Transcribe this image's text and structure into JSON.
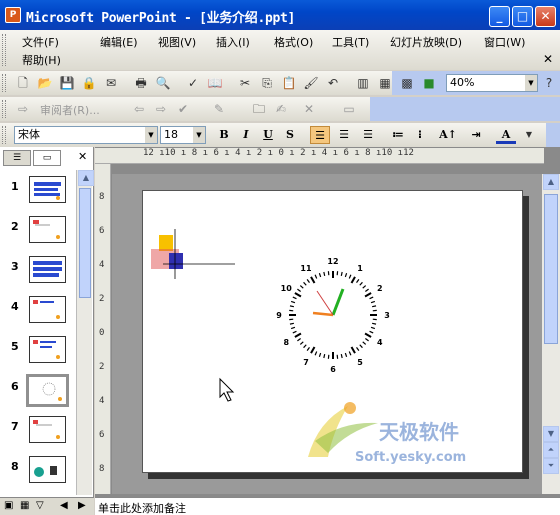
{
  "window": {
    "title": "Microsoft PowerPoint - [业务介绍.ppt]",
    "app_icon": "P"
  },
  "menu": {
    "items": [
      "文件(F)",
      "编辑(E)",
      "视图(V)",
      "插入(I)",
      "格式(O)",
      "工具(T)",
      "幻灯片放映(D)",
      "窗口(W)",
      "帮助(H)"
    ]
  },
  "toolbar": {
    "zoom": "40%"
  },
  "review_toolbar": {
    "reviewer_label": "审阅者(R)..."
  },
  "format_toolbar": {
    "font": "宋体",
    "size": "18",
    "bold": "B",
    "italic": "I",
    "underline": "U",
    "shadow": "S",
    "font_color": "A"
  },
  "ruler_h": "12 ı10 ı 8 ı 6 ı 4 ı 2 ı 0 ı 2 ı 4 ı 6 ı 8 ı10 ı12",
  "ruler_v": [
    "8",
    "6",
    "4",
    "2",
    "0",
    "2",
    "4",
    "6",
    "8"
  ],
  "slides": {
    "numbers": [
      "1",
      "2",
      "3",
      "4",
      "5",
      "6",
      "7",
      "8"
    ],
    "selected": "6"
  },
  "slide": {
    "clock_numbers": [
      "12",
      "1",
      "2",
      "3",
      "4",
      "5",
      "6",
      "7",
      "8",
      "9",
      "10",
      "11"
    ],
    "watermark_text": "天极软件",
    "watermark_url": "Soft.yesky.com"
  },
  "notes": {
    "placeholder": "单击此处添加备注"
  },
  "colors": {
    "title_bar": "#0054e3",
    "clock_green": "#22b022",
    "clock_orange": "#f08020"
  }
}
